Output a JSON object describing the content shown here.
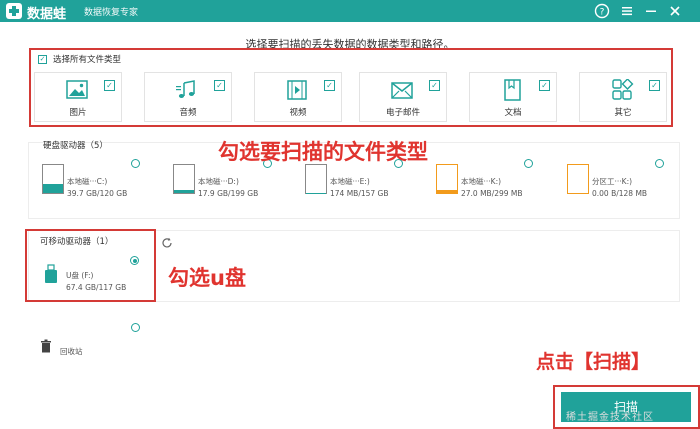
{
  "titlebar": {
    "app_name": "数据蛙",
    "app_subtitle": "数据恢复专家"
  },
  "instruction": "选择要扫描的丢失数据的数据类型和路径。",
  "file_types": {
    "select_all_label": "选择所有文件类型",
    "items": [
      {
        "label": "图片"
      },
      {
        "label": "音频"
      },
      {
        "label": "视频"
      },
      {
        "label": "电子邮件"
      },
      {
        "label": "文档"
      },
      {
        "label": "其它"
      }
    ]
  },
  "hard_drives": {
    "title": "硬盘驱动器（5）",
    "drives": [
      {
        "name": "本地磁···C:)",
        "size": "39.7 GB/120 GB",
        "used": 0.33,
        "color": "#20a29a"
      },
      {
        "name": "本地磁···D:)",
        "size": "17.9 GB/199 GB",
        "used": 0.09,
        "color": "#20a29a"
      },
      {
        "name": "本地磁···E:)",
        "size": "174 MB/157 GB",
        "used": 0.01,
        "color": "#20a29a"
      },
      {
        "name": "本地磁···K:)",
        "size": "27.0 MB/299 MB",
        "used": 0.09,
        "color": "#f29b1c"
      },
      {
        "name": "分区工···K:)",
        "size": "0.00  B/128 MB",
        "used": 0.0,
        "color": "#f29b1c"
      }
    ]
  },
  "removable": {
    "title": "可移动驱动器（1）",
    "drive": {
      "name": "U盘 (F:)",
      "size": "67.4 GB/117 GB"
    }
  },
  "recycle_bin": {
    "label": "回收站"
  },
  "annotations": {
    "select_types": "勾选要扫描的文件类型",
    "select_usb": "勾选u盘",
    "click_scan": "点击【扫描】"
  },
  "scan_button": {
    "label": "扫描"
  },
  "watermark": "稀土掘金技术社区",
  "colors": {
    "accent": "#20a29a",
    "annotation": "#e0342f",
    "warning": "#f29b1c"
  }
}
